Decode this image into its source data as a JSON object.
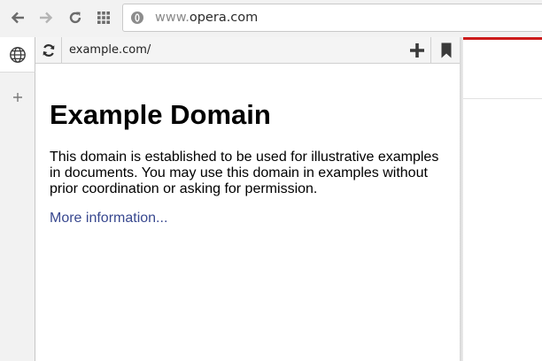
{
  "toolbar": {
    "address": {
      "url_prefix": "www.",
      "url_host": "opera.com",
      "site_icon": "opera-icon"
    },
    "buttons": {
      "back": "back-arrow-icon",
      "forward": "forward-arrow-icon",
      "reload": "reload-icon",
      "speed_dial": "grid-icon"
    }
  },
  "sidebar": {
    "items": [
      {
        "icon": "globe-icon"
      },
      {
        "icon": "plus-icon"
      }
    ]
  },
  "web_panel": {
    "url": "example.com/",
    "icons": {
      "reload": "reload-icon",
      "add": "plus-icon",
      "bookmark": "bookmark-icon"
    },
    "page": {
      "title": "Example Domain",
      "body": "This domain is established to be used for illustrative examples in documents. You may use this domain in examples without prior coordination or asking for permission.",
      "link": "More information..."
    }
  },
  "colors": {
    "accent_red": "#cc1b1b",
    "link": "#38488f",
    "toolbar_bg": "#f2f2f2"
  }
}
